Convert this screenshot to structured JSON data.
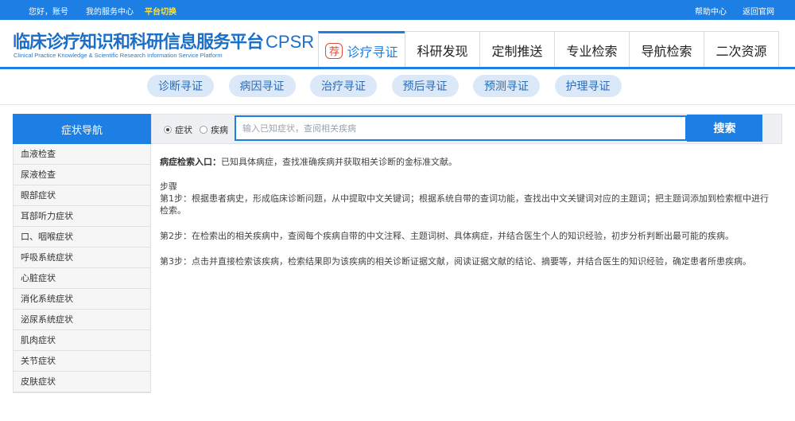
{
  "topbar": {
    "greeting": "您好，",
    "account": "账号",
    "my_service": "我的服务中心",
    "switch": "平台切换",
    "help": "帮助中心",
    "back": "返回官网"
  },
  "logo": {
    "title_cn": "临床诊疗知识和科研信息服务平台",
    "title_en": "CPSR",
    "subtitle": "Clinical Practice Knowledge & Scientific Research Information Service Platform"
  },
  "nav": {
    "tabs": [
      {
        "label": "诊疗寻证",
        "badge": "荐",
        "width": 110
      },
      {
        "label": "科研发现",
        "width": 94
      },
      {
        "label": "定制推送",
        "width": 94
      },
      {
        "label": "专业检索",
        "width": 94
      },
      {
        "label": "导航检索",
        "width": 94
      },
      {
        "label": "二次资源",
        "width": 94
      }
    ]
  },
  "subtabs": [
    "诊断寻证",
    "病因寻证",
    "治疗寻证",
    "预后寻证",
    "预测寻证",
    "护理寻证"
  ],
  "sidebar": {
    "title": "症状导航",
    "items": [
      "血液检查",
      "尿液检查",
      "眼部症状",
      "耳部听力症状",
      "口、咽喉症状",
      "呼吸系统症状",
      "心脏症状",
      "消化系统症状",
      "泌尿系统症状",
      "肌肉症状",
      "关节症状",
      "皮肤症状"
    ]
  },
  "search": {
    "radio_symptom": "症状",
    "radio_disease": "疾病",
    "placeholder": "输入已知症状，查阅相关疾病",
    "button": "搜索"
  },
  "content": {
    "entry_label": "病症检索入口：",
    "entry_text": "已知具体病症，查找准确疾病并获取相关诊断的金标准文献。",
    "steps_title": "步骤",
    "step1": "第1步：根据患者病史，形成临床诊断问题，从中提取中文关键词；根据系统自带的查词功能，查找出中文关键词对应的主题词；把主题词添加到检索框中进行检索。",
    "step2": "第2步：在检索出的相关疾病中，查阅每个疾病自带的中文注释、主题词树、具体病症，并结合医生个人的知识经验，初步分析判断出最可能的疾病。",
    "step3": "第3步：点击并直接检索该疾病，检索结果即为该疾病的相关诊断证据文献，阅读证据文献的结论、摘要等，并结合医生的知识经验，确定患者所患疾病。"
  },
  "colors": {
    "primary": "#1d7ee3",
    "subtab_bg": "#dbe8f7",
    "switch": "#f5e14a",
    "badge": "#e24a3b"
  }
}
